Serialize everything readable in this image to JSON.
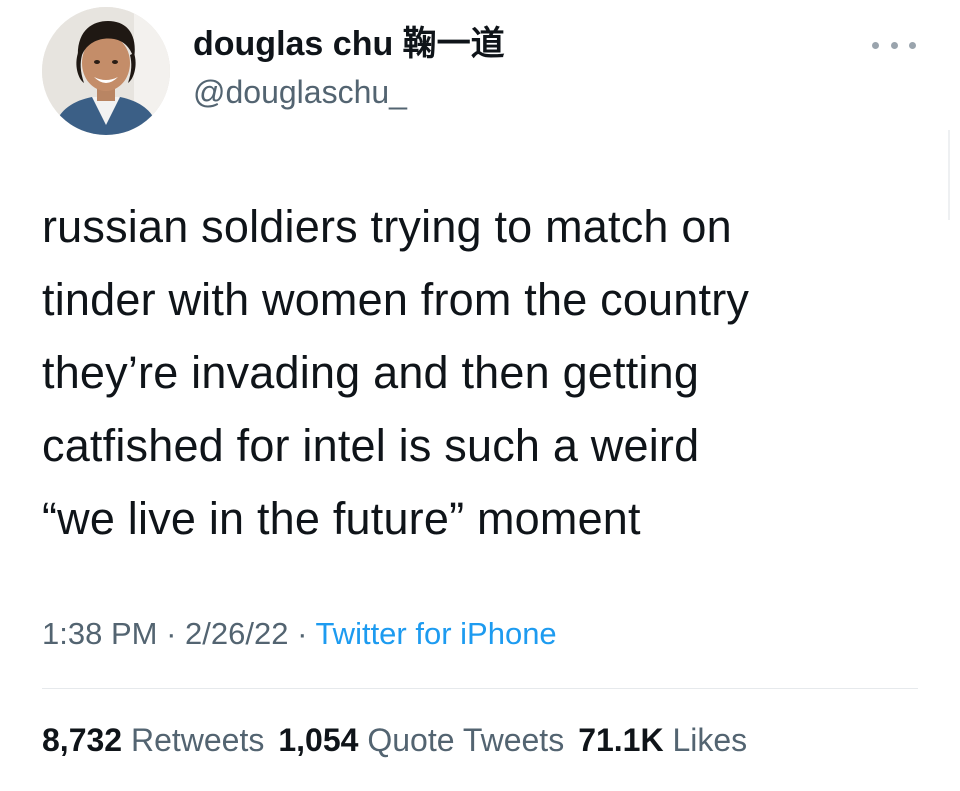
{
  "author": {
    "display_name": "douglas chu 鞠一道",
    "handle": "@douglaschu_",
    "avatar_icon": "profile-photo"
  },
  "menu": {
    "icon": "more-options-icon"
  },
  "tweet": {
    "text": "russian soldiers trying to match on\ntinder with women from the country\nthey’re invading and then getting\ncatfished for intel is such a weird\n“we live in the future” moment"
  },
  "meta": {
    "time": "1:38 PM",
    "sep1": " · ",
    "date": "2/26/22",
    "sep2": " · ",
    "source": "Twitter for iPhone"
  },
  "stats": {
    "retweets_count": "8,732",
    "retweets_label": "Retweets",
    "quotes_count": "1,054",
    "quotes_label": "Quote Tweets",
    "likes_count": "71.1K",
    "likes_label": "Likes"
  },
  "colors": {
    "text": "#0f1419",
    "secondary": "#536471",
    "link": "#1d9bf0",
    "divider": "#e6e9ec"
  }
}
